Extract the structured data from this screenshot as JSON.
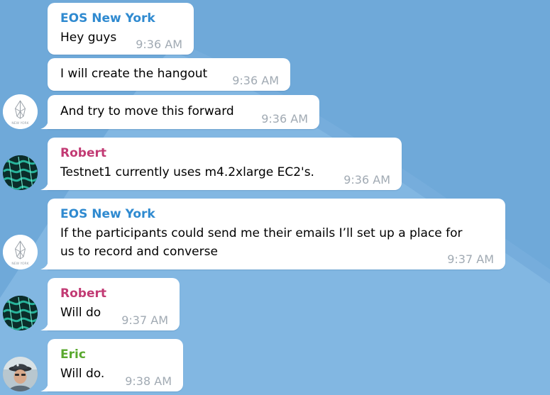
{
  "colors": {
    "background": "#6fa9d9",
    "background_band": "#82b7e2",
    "bubble": "#ffffff",
    "time": "#a1aab3",
    "sender_eos": "#2f8ad0",
    "sender_robert": "#c23b74",
    "sender_eric": "#59a82e"
  },
  "messages": [
    {
      "sender": "EOS New York",
      "text": "Hey guys",
      "time": "9:36 AM"
    },
    {
      "text": "I will create the hangout",
      "time": "9:36 AM"
    },
    {
      "text": "And try to move this forward",
      "time": "9:36 AM",
      "avatar": {
        "icon": "eos-new-york-logo-icon",
        "caption": "NEW YORK"
      }
    },
    {
      "sender": "Robert",
      "text": "Testnet1 currently uses m4.2xlarge EC2's.",
      "time": "9:36 AM",
      "avatar": {
        "icon": "green-pattern-avatar-icon"
      }
    },
    {
      "sender": "EOS New York",
      "text_lines": [
        "If the participants could send me their emails I’ll set up a place for",
        "us to record and converse"
      ],
      "time": "9:37 AM",
      "avatar": {
        "icon": "eos-new-york-logo-icon",
        "caption": "NEW YORK"
      }
    },
    {
      "sender": "Robert",
      "text": "Will do",
      "time": "9:37 AM",
      "avatar": {
        "icon": "green-pattern-avatar-icon"
      }
    },
    {
      "sender": "Eric",
      "text": "Will do.",
      "time": "9:38 AM",
      "avatar": {
        "icon": "user-photo-avatar-icon"
      }
    }
  ]
}
